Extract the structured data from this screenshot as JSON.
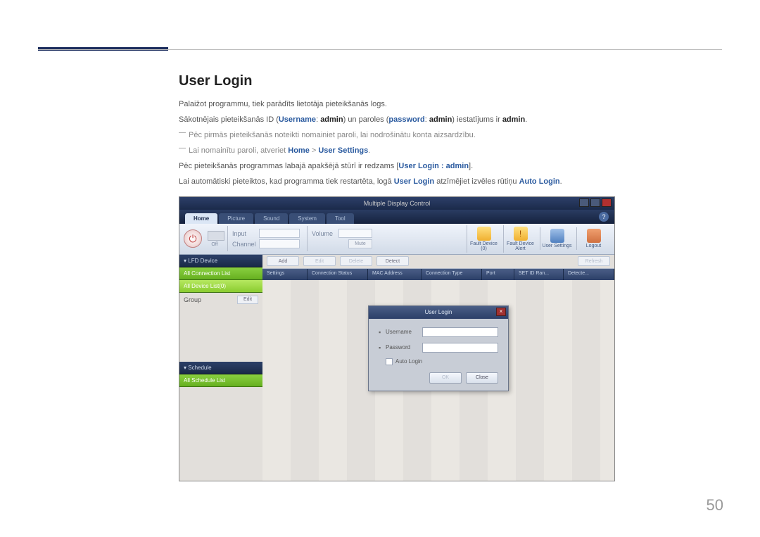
{
  "page": {
    "title": "User Login",
    "p1": "Palaižot programmu, tiek parādīts lietotāja pieteikšanās logs.",
    "p2_pre": "Sākotnējais pieteikšanās ID (",
    "p2_username": "Username",
    "p2_mid1": ": ",
    "p2_admin1": "admin",
    "p2_mid2": ") un paroles (",
    "p2_password": "password",
    "p2_mid3": ": ",
    "p2_admin2": "admin",
    "p2_mid4": ") iestatījums ir ",
    "p2_admin3": "admin",
    "p2_end": ".",
    "note1": "Pēc pirmās pieteikšanās noteikti nomainiet paroli, lai nodrošinātu konta aizsardzību.",
    "note2_pre": "Lai nomainītu paroli, atveriet ",
    "note2_home": "Home",
    "note2_gt": " > ",
    "note2_us": "User Settings",
    "note2_end": ".",
    "p3_pre": "Pēc pieteikšanās programmas labajā apakšējā stūrī ir redzams [",
    "p3_hl": "User Login : admin",
    "p3_end": "].",
    "p4_pre": "Lai automātiski pieteiktos, kad programma tiek restartēta, logā ",
    "p4_ul": "User Login",
    "p4_mid": " atzīmējiet izvēles rūtiņu ",
    "p4_al": "Auto Login",
    "p4_end": ".",
    "pageNumber": "50"
  },
  "app": {
    "title": "Multiple Display Control",
    "tabs": [
      "Home",
      "Picture",
      "Sound",
      "System",
      "Tool"
    ],
    "help": "?",
    "toolbar": {
      "off": "Off",
      "input": "Input",
      "channel": "Channel",
      "volume": "Volume",
      "mute": "Mute",
      "faultDevice": "Fault Device\n(0)",
      "faultAlert": "Fault Device\nAlert",
      "userSettings": "User Settings",
      "logout": "Logout"
    },
    "sidebar": {
      "lfd": "LFD Device",
      "allConn": "All Connection List",
      "allDev": "All Device List(0)",
      "group": "Group",
      "edit": "Edit",
      "schedule": "Schedule",
      "allSchedule": "All Schedule List"
    },
    "wa": {
      "add": "Add",
      "edit": "Edit",
      "delete": "Delete",
      "detect": "Detect",
      "refresh": "Refresh",
      "cols": [
        "Settings",
        "Connection Status",
        "MAC Address",
        "Connection Type",
        "Port",
        "SET ID Ran...",
        "Detecte..."
      ]
    },
    "dialog": {
      "title": "User Login",
      "username": "Username",
      "password": "Password",
      "autoLogin": "Auto Login",
      "ok": "OK",
      "close": "Close"
    }
  }
}
